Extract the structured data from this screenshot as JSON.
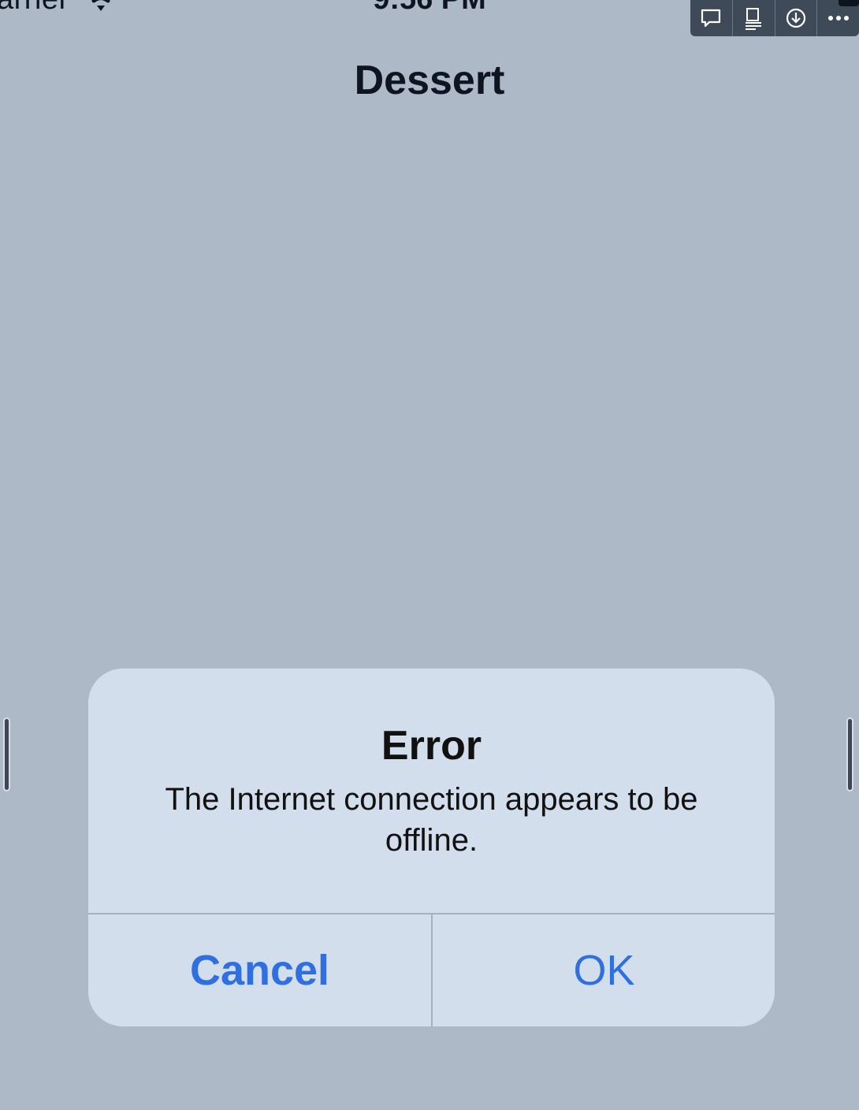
{
  "status_bar": {
    "carrier": "arrier",
    "time": "9:56 PM"
  },
  "toolbar": {
    "icons": [
      "comment-icon",
      "device-layout-icon",
      "download-icon",
      "more-icon"
    ]
  },
  "nav": {
    "title": "Dessert"
  },
  "alert": {
    "title": "Error",
    "message": "The Internet connection appears to be offline.",
    "cancel_label": "Cancel",
    "ok_label": "OK"
  },
  "colors": {
    "background": "#aeb9c7",
    "alert_background": "#d3deec",
    "accent": "#2f6fe0",
    "toolbar": "#3f4a58"
  }
}
